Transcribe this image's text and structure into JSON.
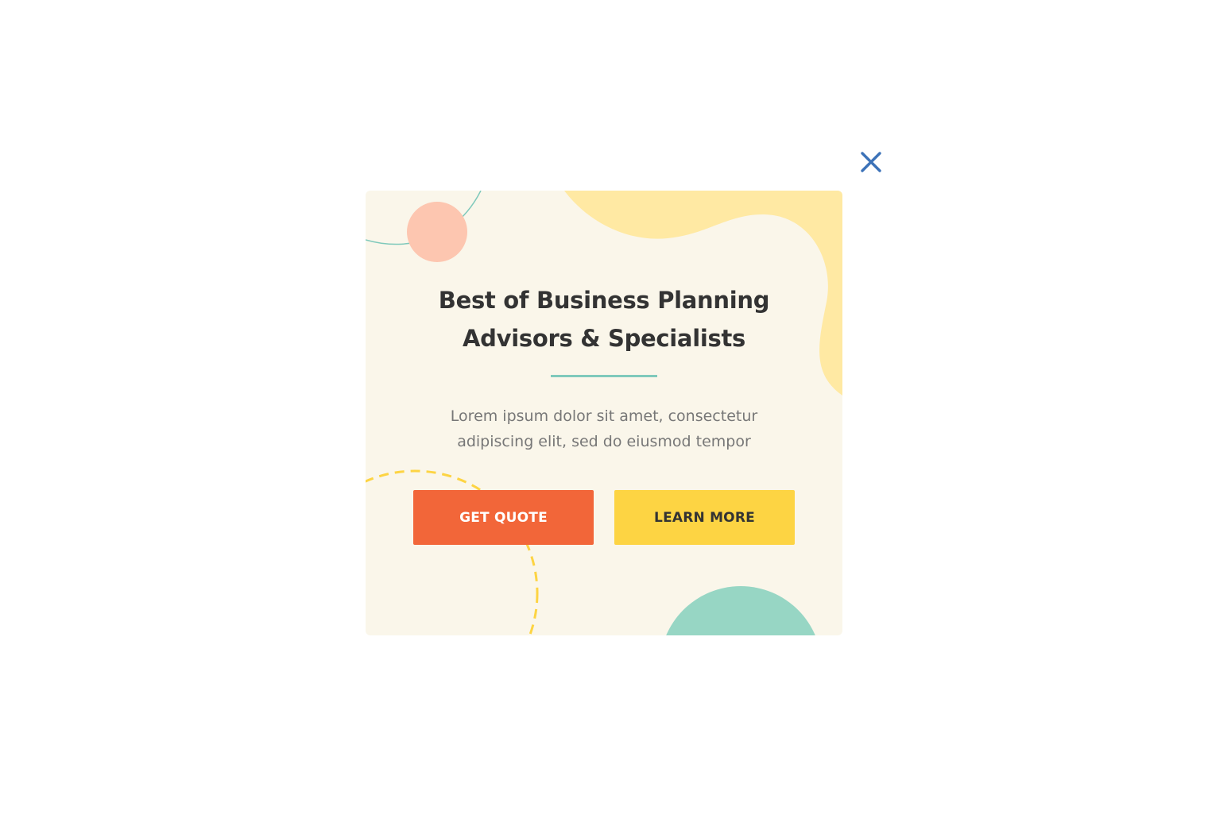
{
  "modal": {
    "title_line1": "Best of Business Planning",
    "title_line2": "Advisors & Specialists",
    "description_line1": "Lorem ipsum dolor sit amet, consectetur",
    "description_line2": "adipiscing elit, sed do eiusmod tempor",
    "primary_button_label": "GET QUOTE",
    "secondary_button_label": "LEARN MORE"
  },
  "icons": {
    "close": "close-icon"
  },
  "colors": {
    "background": "#faf6ea",
    "primary_button": "#f26639",
    "secondary_button": "#fdd443",
    "accent_teal": "#7fc9bb",
    "blob_yellow": "#ffe9a3",
    "circle_peach": "#fdc6b0",
    "circle_teal": "#97d6c4",
    "close_icon": "#3c72b8"
  }
}
